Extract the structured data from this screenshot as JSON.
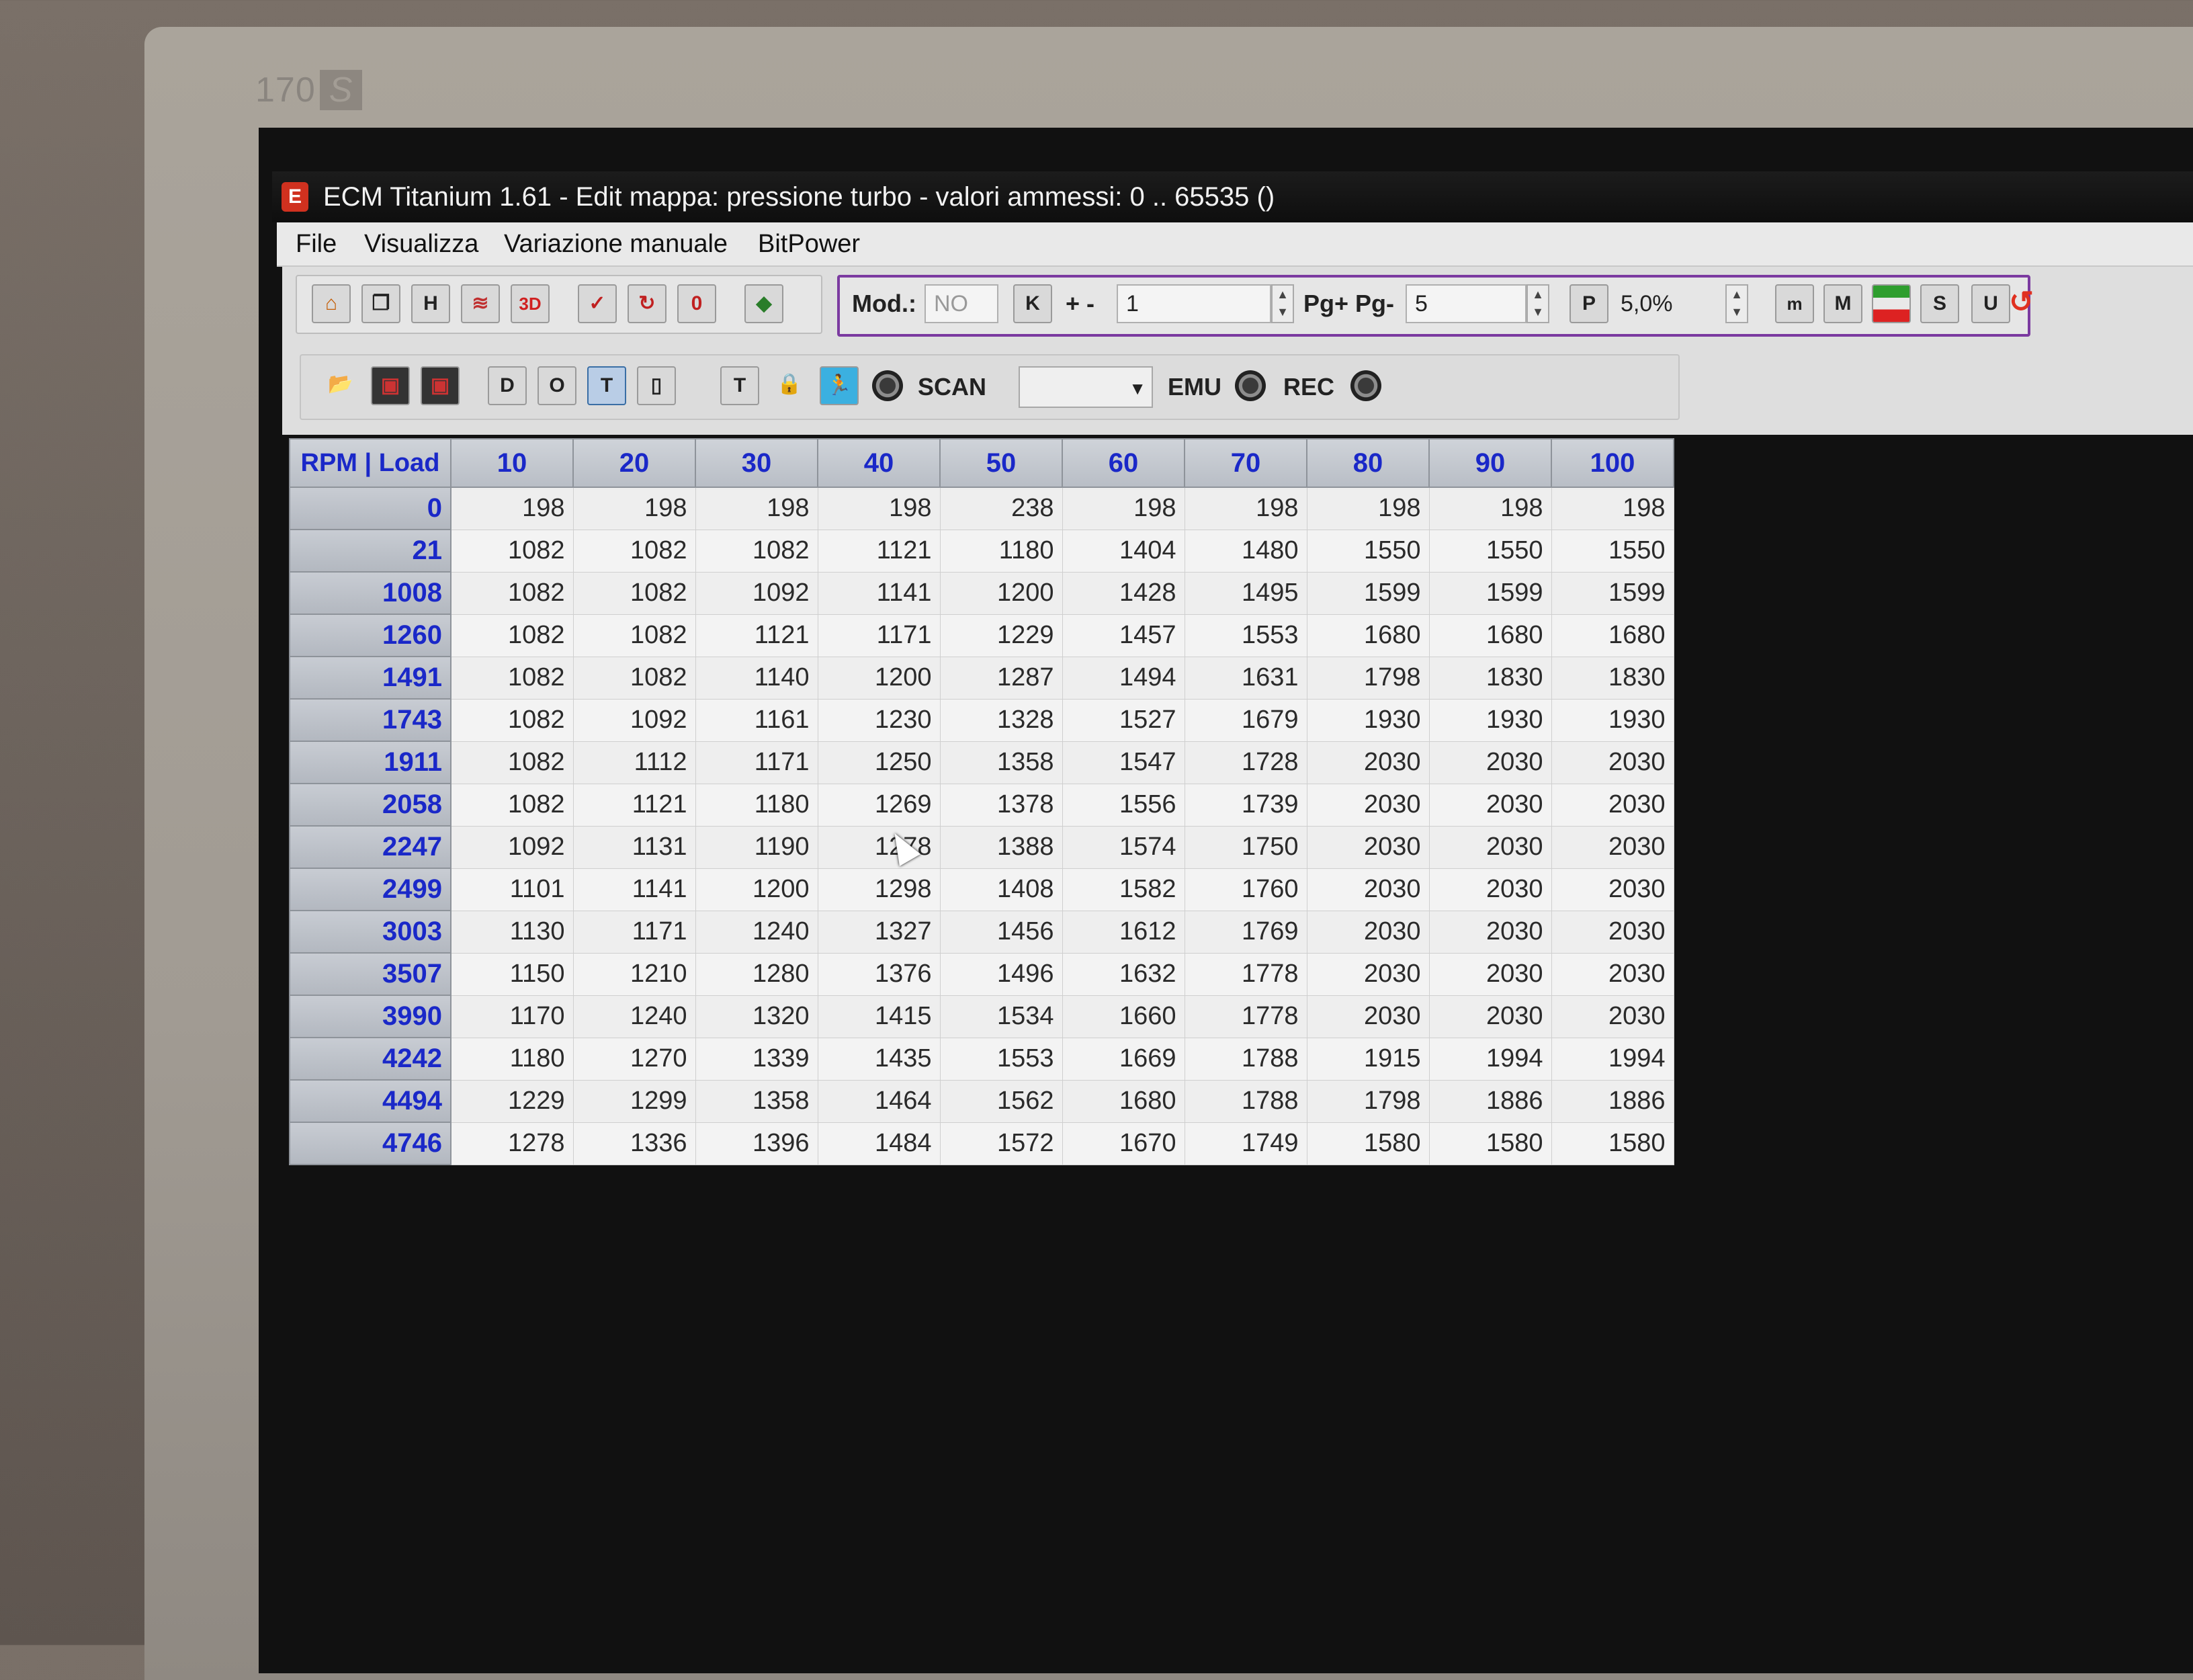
{
  "monitor": {
    "model_number": "170",
    "model_suffix": "S"
  },
  "window": {
    "title": "ECM Titanium 1.61 - Edit mappa: pressione turbo - valori ammessi: 0 .. 65535 ()",
    "icon": "app-logo-icon"
  },
  "menu": [
    "File",
    "Visualizza",
    "Variazione manuale",
    "BitPower"
  ],
  "toolbar1": {
    "icons": [
      "home-icon",
      "copy-maps-icon",
      "h-icon",
      "chart-2d-icon",
      "chart-3d-icon",
      "check-icon",
      "refresh-icon",
      "zero-icon",
      "tricolor-icon"
    ],
    "icon_3d_label": "3D",
    "mod_label": "Mod.:",
    "mod_value": "NO",
    "k_label": "K",
    "plusminus_label": "+ -",
    "step_value": "1",
    "pg_label": "Pg+ Pg-",
    "pg_value": "5",
    "p_label": "P",
    "percent_value": "5,0%",
    "right_icons": [
      "m-small-icon",
      "m-icon",
      "flag-icon",
      "s-icon",
      "u-icon",
      "reset-icon"
    ],
    "right_labels": [
      "m",
      "M",
      "",
      "S",
      "U",
      ""
    ]
  },
  "toolbar2": {
    "icons": [
      "open-folder-icon",
      "save-icon",
      "save-as-icon",
      "d-icon",
      "o-icon",
      "t-pressed-icon",
      "column-icon",
      "t-icon",
      "lock-icon",
      "runner-icon",
      "led-icon"
    ],
    "icon_labels": [
      "",
      "",
      "",
      "D",
      "O",
      "T",
      "",
      "T",
      "",
      "",
      ""
    ],
    "scan_label": "SCAN",
    "scan_value": "",
    "emu_label": "EMU",
    "rec_label": "REC"
  },
  "table": {
    "corner": "RPM | Load",
    "columns": [
      "10",
      "20",
      "30",
      "40",
      "50",
      "60",
      "70",
      "80",
      "90",
      "100"
    ],
    "rows": [
      {
        "rpm": "0",
        "values": [
          "198",
          "198",
          "198",
          "198",
          "238",
          "198",
          "198",
          "198",
          "198",
          "198"
        ]
      },
      {
        "rpm": "21",
        "values": [
          "1082",
          "1082",
          "1082",
          "1121",
          "1180",
          "1404",
          "1480",
          "1550",
          "1550",
          "1550"
        ]
      },
      {
        "rpm": "1008",
        "values": [
          "1082",
          "1082",
          "1092",
          "1141",
          "1200",
          "1428",
          "1495",
          "1599",
          "1599",
          "1599"
        ]
      },
      {
        "rpm": "1260",
        "values": [
          "1082",
          "1082",
          "1121",
          "1171",
          "1229",
          "1457",
          "1553",
          "1680",
          "1680",
          "1680"
        ]
      },
      {
        "rpm": "1491",
        "values": [
          "1082",
          "1082",
          "1140",
          "1200",
          "1287",
          "1494",
          "1631",
          "1798",
          "1830",
          "1830"
        ]
      },
      {
        "rpm": "1743",
        "values": [
          "1082",
          "1092",
          "1161",
          "1230",
          "1328",
          "1527",
          "1679",
          "1930",
          "1930",
          "1930"
        ]
      },
      {
        "rpm": "1911",
        "values": [
          "1082",
          "1112",
          "1171",
          "1250",
          "1358",
          "1547",
          "1728",
          "2030",
          "2030",
          "2030"
        ]
      },
      {
        "rpm": "2058",
        "values": [
          "1082",
          "1121",
          "1180",
          "1269",
          "1378",
          "1556",
          "1739",
          "2030",
          "2030",
          "2030"
        ]
      },
      {
        "rpm": "2247",
        "values": [
          "1092",
          "1131",
          "1190",
          "1278",
          "1388",
          "1574",
          "1750",
          "2030",
          "2030",
          "2030"
        ]
      },
      {
        "rpm": "2499",
        "values": [
          "1101",
          "1141",
          "1200",
          "1298",
          "1408",
          "1582",
          "1760",
          "2030",
          "2030",
          "2030"
        ]
      },
      {
        "rpm": "3003",
        "values": [
          "1130",
          "1171",
          "1240",
          "1327",
          "1456",
          "1612",
          "1769",
          "2030",
          "2030",
          "2030"
        ]
      },
      {
        "rpm": "3507",
        "values": [
          "1150",
          "1210",
          "1280",
          "1376",
          "1496",
          "1632",
          "1778",
          "2030",
          "2030",
          "2030"
        ]
      },
      {
        "rpm": "3990",
        "values": [
          "1170",
          "1240",
          "1320",
          "1415",
          "1534",
          "1660",
          "1778",
          "2030",
          "2030",
          "2030"
        ]
      },
      {
        "rpm": "4242",
        "values": [
          "1180",
          "1270",
          "1339",
          "1435",
          "1553",
          "1669",
          "1788",
          "1915",
          "1994",
          "1994"
        ]
      },
      {
        "rpm": "4494",
        "values": [
          "1229",
          "1299",
          "1358",
          "1464",
          "1562",
          "1680",
          "1788",
          "1798",
          "1886",
          "1886"
        ]
      },
      {
        "rpm": "4746",
        "values": [
          "1278",
          "1336",
          "1396",
          "1484",
          "1572",
          "1670",
          "1749",
          "1580",
          "1580",
          "1580"
        ]
      }
    ]
  },
  "colors": {
    "header_text": "#1a28c8",
    "title_bar": "#111111",
    "screen_bg": "#111111"
  }
}
